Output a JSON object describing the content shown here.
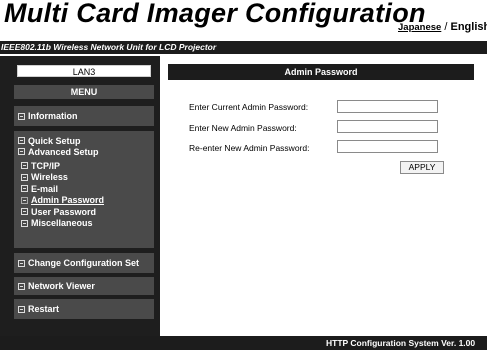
{
  "header": {
    "title": "Multi Card Imager Configuration",
    "lang_japanese": "Japanese",
    "lang_separator": "/",
    "lang_english": "English"
  },
  "subtitle": "IEEE802.11b Wireless Network Unit for LCD Projector",
  "sidebar": {
    "device_name": "LAN3",
    "menu_heading": "MENU",
    "information": "Information",
    "quick_setup": "Quick Setup",
    "advanced_setup": "Advanced Setup",
    "advanced_items": [
      {
        "label": "TCP/IP"
      },
      {
        "label": "Wireless"
      },
      {
        "label": "E-mail"
      },
      {
        "label": "Admin Password"
      },
      {
        "label": "User Password"
      },
      {
        "label": "Miscellaneous"
      }
    ],
    "change_configuration_set": "Change Configuration Set",
    "network_viewer": "Network Viewer",
    "restart": "Restart"
  },
  "main": {
    "section_title": "Admin Password",
    "fields": [
      {
        "label": "Enter Current Admin Password:",
        "value": ""
      },
      {
        "label": "Enter New Admin Password:",
        "value": ""
      },
      {
        "label": "Re-enter New Admin Password:",
        "value": ""
      }
    ],
    "apply_label": "APPLY"
  },
  "footer": {
    "text": "HTTP Configuration System Ver. 1.00"
  },
  "icons": {
    "menu_item_icon": "box-minus-icon"
  },
  "colors": {
    "dark_bar": "#1c1c1c",
    "sidebar_bg": "#1e1e1e",
    "menu_band": "#4a4a4a"
  }
}
